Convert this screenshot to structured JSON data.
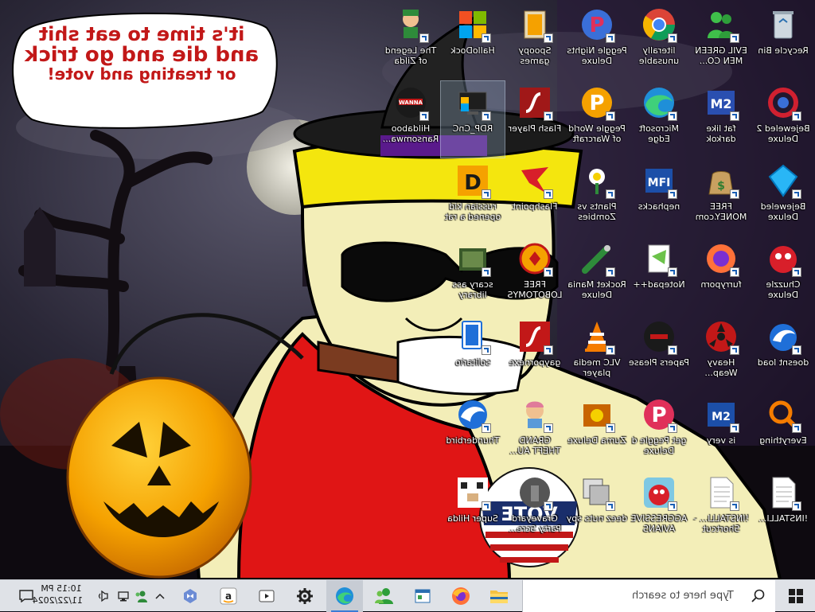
{
  "bubble": {
    "line1": "it's time to eat shit",
    "line2": "and die and go trick",
    "line3": "or treating and vote!"
  },
  "icons": [
    {
      "name": "recycle-bin-icon",
      "label": "Recycle Bin",
      "selected": false
    },
    {
      "name": "evil-green-men-icon",
      "label": "EVIL GREEN MEN CO..."
    },
    {
      "name": "chrome-icon",
      "label": "literally unusable"
    },
    {
      "name": "peggle-nights-icon",
      "label": "Peggle Nights Deluxe"
    },
    {
      "name": "spoopy-games-icon",
      "label": "Spoopy games"
    },
    {
      "name": "hallodock-icon",
      "label": "HalloDock"
    },
    {
      "name": "legend-of-zilda-icon",
      "label": "The Legend of Zilda"
    },
    {
      "name": "bejeweled-2-icon",
      "label": "Bejeweled 2 Deluxe"
    },
    {
      "name": "fat-like-darkok-icon",
      "label": "fat like darkok"
    },
    {
      "name": "edge-icon",
      "label": "Microsoft Edge"
    },
    {
      "name": "peggle-world-warcraft-icon",
      "label": "Peggle World of Warcraft"
    },
    {
      "name": "flash-player-icon",
      "label": "Flash Player"
    },
    {
      "name": "rdp-cnc-icon",
      "label": "RDP_CnC"
    },
    {
      "name": "hildaboo-ransomware-icon",
      "label": "Hildaboo Ransomwa..."
    },
    {
      "name": "bejeweled-deluxe-icon",
      "label": "Bejeweled Deluxe"
    },
    {
      "name": "free-money-icon",
      "label": "FREE MONEY.com"
    },
    {
      "name": "nephacks-icon",
      "label": "nephacks"
    },
    {
      "name": "plants-vs-zombies-icon",
      "label": "Plants vs Zombies"
    },
    {
      "name": "flashpoint-icon",
      "label": "Flashpoint"
    },
    {
      "name": "russian-kid-icon",
      "label": "russian kid opened a rat"
    },
    {
      "name": "chuzzle-deluxe-icon",
      "label": "Chuzzle Deluxe"
    },
    {
      "name": "furryporn-icon",
      "label": "furryporn"
    },
    {
      "name": "notepadpp-icon",
      "label": "Notepad++"
    },
    {
      "name": "rocket-mania-icon",
      "label": "Rocket Mania Deluxe"
    },
    {
      "name": "free-lobotomys-icon",
      "label": "FREE LOBOTOMYS"
    },
    {
      "name": "scary-ass-library-icon",
      "label": "scary ass library"
    },
    {
      "name": "doesnt-load-icon",
      "label": "doesnt load"
    },
    {
      "name": "heavy-weapon-icon",
      "label": "Heavy Weap..."
    },
    {
      "name": "papers-please-icon",
      "label": "Papers Please"
    },
    {
      "name": "vlc-icon",
      "label": "VLC media player"
    },
    {
      "name": "gaypornexe-icon",
      "label": "gaypornexe"
    },
    {
      "name": "solitario-icon",
      "label": "solitario"
    },
    {
      "name": "everything-icon",
      "label": "Everything"
    },
    {
      "name": "is-very-icon",
      "label": "is very"
    },
    {
      "name": "get-peggle-icon",
      "label": "get Peggle d Deluxe"
    },
    {
      "name": "zuma-deluxe-icon",
      "label": "Zuma Deluxe"
    },
    {
      "name": "grand-theft-icon",
      "label": "GRAND THEFT AU..."
    },
    {
      "name": "thunderbird-icon",
      "label": "Thunderbird"
    },
    {
      "name": "installi-1-icon",
      "label": "!INSTALLI..."
    },
    {
      "name": "installi-2-icon",
      "label": "!INSTALLI... - Shortcut"
    },
    {
      "name": "aggressive-avians-icon",
      "label": "AGGRESSIVE AVIANS"
    },
    {
      "name": "deez-nuts-spy-icon",
      "label": "deez nuts spy"
    },
    {
      "name": "graveyard-party-icon",
      "label": "Graveyard Party Scre..."
    },
    {
      "name": "super-hilda-icon",
      "label": "Super Hilda"
    }
  ],
  "taskbar": {
    "search_placeholder": "Type here to search",
    "time": "10:15 PM",
    "date": "11/22/2024",
    "apps": [
      "explorer",
      "firefox",
      "teams",
      "edge",
      "settings",
      "media-player",
      "amazon",
      "visual-studio"
    ]
  },
  "colors": {
    "bubble_text": "#c21818",
    "taskbar_bg": "#dfe2e7"
  }
}
